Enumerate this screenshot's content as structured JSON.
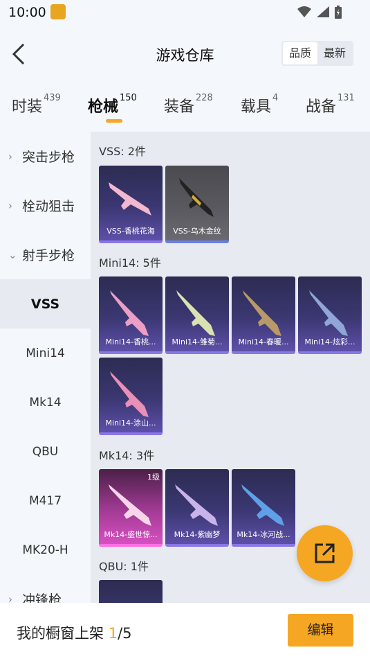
{
  "status_bar": {
    "time": "10:00"
  },
  "header": {
    "title": "游戏仓库",
    "sort_options": [
      "品质",
      "最新"
    ],
    "sort_selected": "品质"
  },
  "tabs": [
    {
      "label": "时装",
      "count": "439"
    },
    {
      "label": "枪械",
      "count": "150"
    },
    {
      "label": "装备",
      "count": "228"
    },
    {
      "label": "载具",
      "count": "4"
    },
    {
      "label": "战备",
      "count": "131"
    }
  ],
  "active_tab": "枪械",
  "sidebar": {
    "categories": [
      "突击步枪",
      "栓动狙击",
      "射手步枪"
    ],
    "subitems": [
      "VSS",
      "Mini14",
      "Mk14",
      "QBU",
      "M417",
      "MK20-H"
    ],
    "next_category": "冲锋枪",
    "active_subitem": "VSS"
  },
  "groups": [
    {
      "title": "VSS: 2件",
      "items": [
        {
          "name": "VSS-香桃花海"
        },
        {
          "name": "VSS-乌木金纹"
        }
      ]
    },
    {
      "title": "Mini14: 5件",
      "items": [
        {
          "name": "Mini14-香桃..."
        },
        {
          "name": "Mini14-雏菊..."
        },
        {
          "name": "Mini14-春暖..."
        },
        {
          "name": "Mini14-炫彩..."
        },
        {
          "name": "Mini14-涂山..."
        }
      ]
    },
    {
      "title": "Mk14: 3件",
      "items": [
        {
          "name": "Mk14-盛世惊...",
          "level": "1级"
        },
        {
          "name": "Mk14-紫幽梦"
        },
        {
          "name": "Mk14-冰河战..."
        }
      ]
    },
    {
      "title": "QBU: 1件",
      "items": []
    }
  ],
  "bottom_bar": {
    "label": "我的橱窗上架 ",
    "current": "1",
    "total": "/5",
    "edit_label": "编辑"
  },
  "colors": {
    "accent": "#f5a623",
    "card_purple": "#3b3772",
    "card_pink": "#d650c0"
  }
}
